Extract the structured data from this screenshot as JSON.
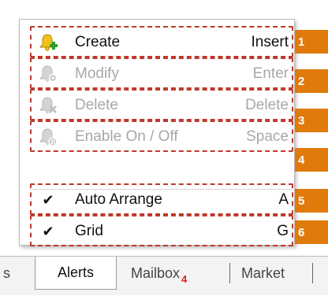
{
  "menu": {
    "items": [
      {
        "label": "Create",
        "shortcut": "Insert",
        "icon": "bell-add-icon",
        "enabled": true
      },
      {
        "label": "Modify",
        "shortcut": "Enter",
        "icon": "bell-gear-icon",
        "enabled": false
      },
      {
        "label": "Delete",
        "shortcut": "Delete",
        "icon": "bell-delete-icon",
        "enabled": false
      },
      {
        "label": "Enable On / Off",
        "shortcut": "Space",
        "icon": "bell-toggle-icon",
        "enabled": false
      },
      {
        "label": "Auto Arrange",
        "shortcut": "A",
        "checked": true
      },
      {
        "label": "Grid",
        "shortcut": "G",
        "checked": true
      }
    ],
    "check_glyph": "✔"
  },
  "markers": [
    "1",
    "2",
    "3",
    "4",
    "5",
    "6"
  ],
  "tabs": {
    "partial_left": "s",
    "active": "Alerts",
    "mailbox": "Mailbox",
    "mailbox_badge": "4",
    "market": "Market"
  },
  "colors": {
    "highlight": "#c0392b",
    "marker": "#e07a0b",
    "badge": "#e0201b",
    "bell_yellow": "#f2c21b",
    "plus_green": "#2e9e2e"
  }
}
